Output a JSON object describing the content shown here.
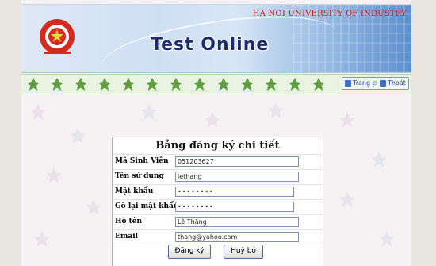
{
  "header": {
    "university": "HA NOI UNIVERSITY OF INDUSTRY",
    "app_title": "Test Online",
    "nav": [
      {
        "label": "Trang chủ",
        "icon": "home-icon"
      },
      {
        "label": "Thoát",
        "icon": "exit-icon"
      }
    ]
  },
  "form": {
    "title": "Bảng đăng ký chi tiết",
    "fields": [
      {
        "label": "Mã Sinh Viên",
        "value": "051203627"
      },
      {
        "label": "Tên sử dụng",
        "value": "lethang"
      },
      {
        "label": "Mật khẩu",
        "value": "••••••••"
      },
      {
        "label": "Gõ lại mật khẩu",
        "value": "••••••••"
      },
      {
        "label": "Họ tên",
        "value": "Lê Thắng"
      },
      {
        "label": "Email",
        "value": "thang@yahoo.com"
      }
    ],
    "submit_label": "Đăng ký",
    "cancel_label": "Huỷ bỏ"
  },
  "colors": {
    "university_text": "#c8201a",
    "title_text": "#1d2c6b",
    "leaf_green": "#5f9e3d"
  }
}
